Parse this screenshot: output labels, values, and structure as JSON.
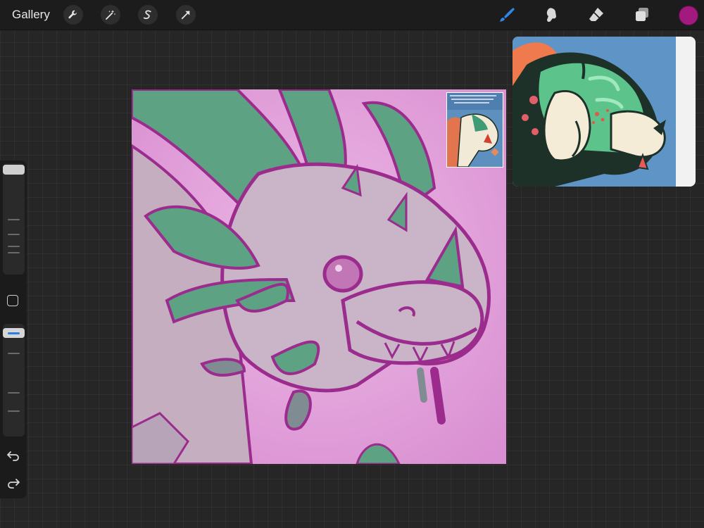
{
  "topbar": {
    "gallery_label": "Gallery",
    "left_tools": [
      "wrench-icon",
      "magic-wand-icon",
      "selection-s-icon",
      "transform-arrow-icon"
    ],
    "right_tools": [
      "brush-icon",
      "smudge-icon",
      "eraser-icon",
      "layers-icon"
    ],
    "active_color": "#a2197f"
  },
  "sidebar": {
    "brush_size_level": 0.02,
    "opacity_level": 0.02,
    "undo_icon": "undo-icon",
    "redo_icon": "redo-icon"
  },
  "canvas": {
    "background_color": "#e2a4dc",
    "line_color": "#9b2c8e",
    "accent_color": "#5ca283",
    "thumbnail_text": "..."
  },
  "reference_window": {
    "present": true
  }
}
